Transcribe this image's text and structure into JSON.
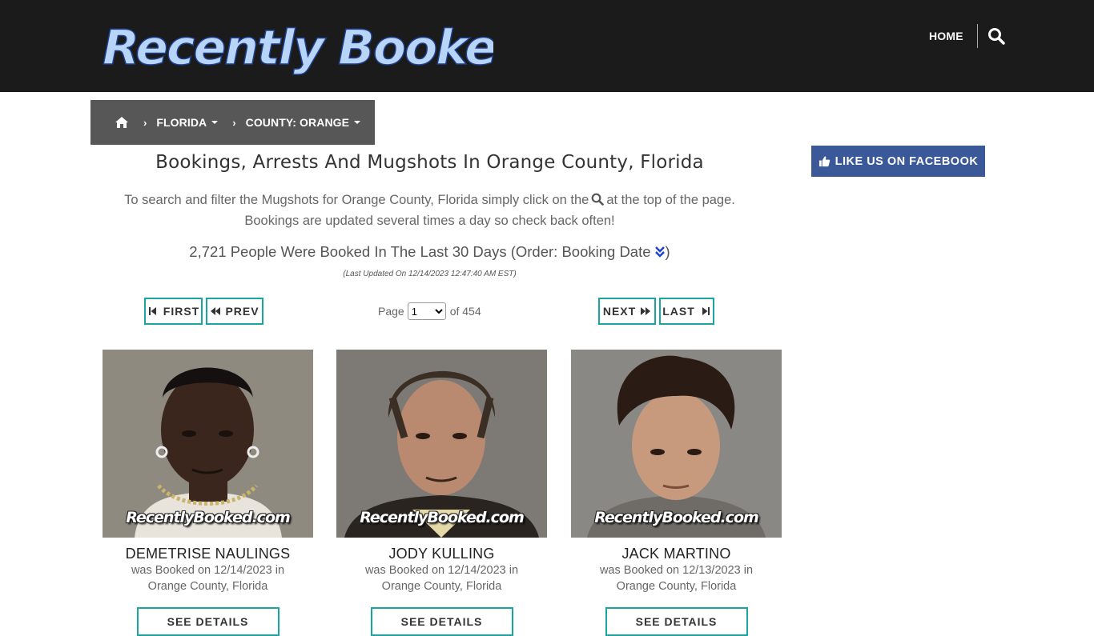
{
  "header": {
    "logo_text": "Recently Booked",
    "nav_home": "HOME",
    "search_icon": "search-icon"
  },
  "breadcrumb": {
    "home_icon": "home-icon",
    "state": "FLORIDA",
    "county": "COUNTY: ORANGE"
  },
  "facebook": {
    "label": "LIKE US ON FACEBOOK",
    "color": "#3b5998"
  },
  "main": {
    "title": "Bookings, Arrests And Mugshots In Orange County, Florida",
    "intro_before": "To search and filter the Mugshots for Orange County, Florida simply click on the",
    "intro_after": "at the top of the page.",
    "intro_line2": "Bookings are updated several times a day so check back often!",
    "count_text": "2,721 People Were Booked In The Last 30 Days (Order: Booking Date",
    "count_close": ")",
    "updated": "(Last Updated On 12/14/2023 12:47:40 AM EST)"
  },
  "pagination": {
    "first": "FIRST",
    "prev": "PREV",
    "next": "NEXT",
    "last": "LAST",
    "page_label": "Page",
    "current_page": "1",
    "of_label": "of 454",
    "accent": "#1aa5a1"
  },
  "bookings": [
    {
      "name": "DEMETRISE NAULINGS",
      "line1": "was Booked on 12/14/2023 in",
      "line2": "Orange County, Florida",
      "watermark": "RecentlyBooked.com",
      "button": "SEE DETAILS"
    },
    {
      "name": "JODY KULLING",
      "line1": "was Booked on 12/14/2023 in",
      "line2": "Orange County, Florida",
      "watermark": "RecentlyBooked.com",
      "button": "SEE DETAILS"
    },
    {
      "name": "JACK MARTINO",
      "line1": "was Booked on 12/13/2023 in",
      "line2": "Orange County, Florida",
      "watermark": "RecentlyBooked.com",
      "button": "SEE DETAILS"
    }
  ]
}
